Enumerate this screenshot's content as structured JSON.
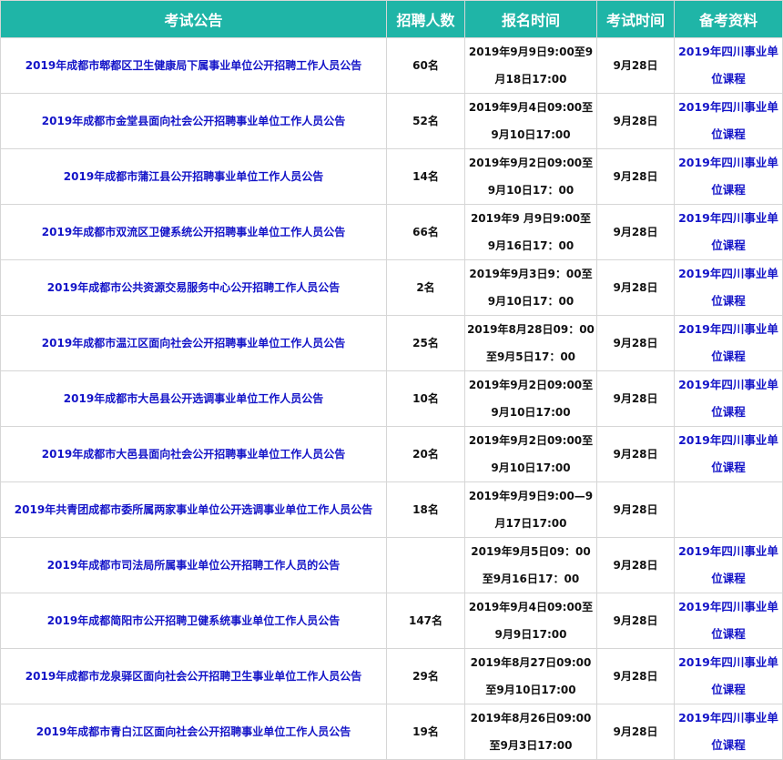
{
  "headers": [
    "考试公告",
    "招聘人数",
    "报名时间",
    "考试时间",
    "备考资料"
  ],
  "rows": [
    {
      "title": "2019年成都市郫都区卫生健康局下属事业单位公开招聘工作人员公告",
      "count": "60名",
      "reg": "2019年9月9日9:00至9月18日17:00",
      "exam": "9月28日",
      "study": "2019年四川事业单位课程"
    },
    {
      "title": "2019年成都市金堂县面向社会公开招聘事业单位工作人员公告",
      "count": "52名",
      "reg": "2019年9月4日09:00至9月10日17:00",
      "exam": "9月28日",
      "study": "2019年四川事业单位课程"
    },
    {
      "title": "2019年成都市蒲江县公开招聘事业单位工作人员公告",
      "count": "14名",
      "reg": "2019年9月2日09:00至9月10日17：00",
      "exam": "9月28日",
      "study": "2019年四川事业单位课程"
    },
    {
      "title": "2019年成都市双流区卫健系统公开招聘事业单位工作人员公告",
      "count": "66名",
      "reg": "2019年9 月9日9:00至 9月16日17：00",
      "exam": "9月28日",
      "study": "2019年四川事业单位课程"
    },
    {
      "title": "2019年成都市公共资源交易服务中心公开招聘工作人员公告",
      "count": "2名",
      "reg": "2019年9月3日9：00至9月10日17：00",
      "exam": "9月28日",
      "study": "2019年四川事业单位课程"
    },
    {
      "title": "2019年成都市温江区面向社会公开招聘事业单位工作人员公告",
      "count": "25名",
      "reg": "2019年8月28日09：00至9月5日17：00",
      "exam": "9月28日",
      "study": "2019年四川事业单位课程"
    },
    {
      "title": "2019年成都市大邑县公开选调事业单位工作人员公告",
      "count": "10名",
      "reg": "2019年9月2日09:00至9月10日17:00",
      "exam": "9月28日",
      "study": "2019年四川事业单位课程"
    },
    {
      "title": "2019年成都市大邑县面向社会公开招聘事业单位工作人员公告",
      "count": "20名",
      "reg": "2019年9月2日09:00至9月10日17:00",
      "exam": "9月28日",
      "study": "2019年四川事业单位课程"
    },
    {
      "title": "2019年共青团成都市委所属两家事业单位公开选调事业单位工作人员公告",
      "count": "18名",
      "reg": "2019年9月9日9:00—9月17日17:00",
      "exam": "9月28日",
      "study": ""
    },
    {
      "title": "2019年成都市司法局所属事业单位公开招聘工作人员的公告",
      "count": "",
      "reg": "2019年9月5日09：00至9月16日17：00",
      "exam": "9月28日",
      "study": "2019年四川事业单位课程"
    },
    {
      "title": "2019年成都简阳市公开招聘卫健系统事业单位工作人员公告",
      "count": "147名",
      "reg": "2019年9月4日09:00至9月9日17:00",
      "exam": "9月28日",
      "study": "2019年四川事业单位课程"
    },
    {
      "title": "2019年成都市龙泉驿区面向社会公开招聘卫生事业单位工作人员公告",
      "count": "29名",
      "reg": "2019年8月27日09:00至9月10日17:00",
      "exam": "9月28日",
      "study": "2019年四川事业单位课程"
    },
    {
      "title": "2019年成都市青白江区面向社会公开招聘事业单位工作人员公告",
      "count": "19名",
      "reg": "2019年8月26日09:00至9月3日17:00",
      "exam": "9月28日",
      "study": "2019年四川事业单位课程"
    }
  ],
  "colors": {
    "header_bg": "#1fb5a7",
    "link": "#1414c8"
  }
}
